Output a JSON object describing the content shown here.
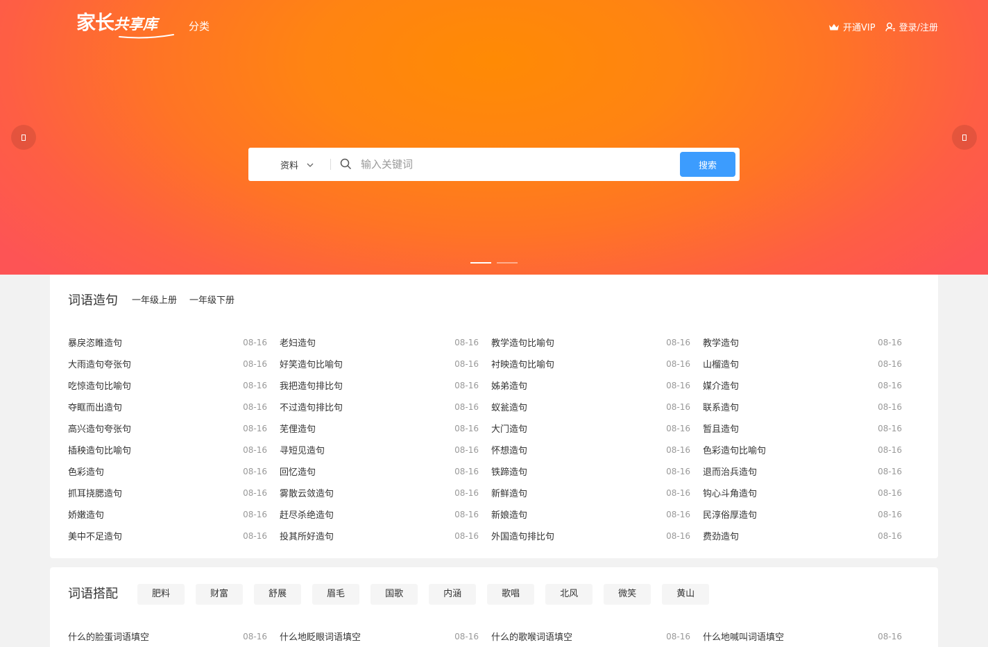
{
  "header": {
    "logo_main": "家长",
    "logo_sub": "共享库",
    "nav_category": "分类",
    "vip_label": "开通VIP",
    "login_label": "登录/注册"
  },
  "search": {
    "type_label": "资料",
    "placeholder": "输入关键词",
    "button_label": "搜索"
  },
  "icons": {
    "prev": "chevron-left-icon",
    "next": "chevron-right-icon",
    "vip": "crown-icon",
    "login": "user-icon",
    "search": "search-icon",
    "dropdown": "chevron-down-icon"
  },
  "colors": {
    "hero_center": "#ff8a04",
    "hero_edge": "#fd5455",
    "search_button": "#3c9cfe"
  },
  "carousel": {
    "slide_count": 2,
    "active_index": 0
  },
  "sections": [
    {
      "title": "词语造句",
      "tabs": [
        "一年级上册",
        "一年级下册"
      ],
      "items": [
        {
          "title": "暴戾恣睢造句",
          "date": "08-16"
        },
        {
          "title": "老妇造句",
          "date": "08-16"
        },
        {
          "title": "教学造句比喻句",
          "date": "08-16"
        },
        {
          "title": "教学造句",
          "date": "08-16"
        },
        {
          "title": "大雨造句夸张句",
          "date": "08-16"
        },
        {
          "title": "好笑造句比喻句",
          "date": "08-16"
        },
        {
          "title": "衬映造句比喻句",
          "date": "08-16"
        },
        {
          "title": "山榴造句",
          "date": "08-16"
        },
        {
          "title": "吃惊造句比喻句",
          "date": "08-16"
        },
        {
          "title": "我把造句排比句",
          "date": "08-16"
        },
        {
          "title": "姊弟造句",
          "date": "08-16"
        },
        {
          "title": "媒介造句",
          "date": "08-16"
        },
        {
          "title": "夺眶而出造句",
          "date": "08-16"
        },
        {
          "title": "不过造句排比句",
          "date": "08-16"
        },
        {
          "title": "蚁瓮造句",
          "date": "08-16"
        },
        {
          "title": "联系造句",
          "date": "08-16"
        },
        {
          "title": "高兴造句夸张句",
          "date": "08-16"
        },
        {
          "title": "芜俚造句",
          "date": "08-16"
        },
        {
          "title": "大门造句",
          "date": "08-16"
        },
        {
          "title": "暂且造句",
          "date": "08-16"
        },
        {
          "title": "插秧造句比喻句",
          "date": "08-16"
        },
        {
          "title": "寻短见造句",
          "date": "08-16"
        },
        {
          "title": "怀想造句",
          "date": "08-16"
        },
        {
          "title": "色彩造句比喻句",
          "date": "08-16"
        },
        {
          "title": "色彩造句",
          "date": "08-16"
        },
        {
          "title": "回忆造句",
          "date": "08-16"
        },
        {
          "title": "铁蹄造句",
          "date": "08-16"
        },
        {
          "title": "退而治兵造句",
          "date": "08-16"
        },
        {
          "title": "抓耳挠腮造句",
          "date": "08-16"
        },
        {
          "title": "雾散云敛造句",
          "date": "08-16"
        },
        {
          "title": "新鲜造句",
          "date": "08-16"
        },
        {
          "title": "钩心斗角造句",
          "date": "08-16"
        },
        {
          "title": "娇嫩造句",
          "date": "08-16"
        },
        {
          "title": "赶尽杀绝造句",
          "date": "08-16"
        },
        {
          "title": "新娘造句",
          "date": "08-16"
        },
        {
          "title": "民淳俗厚造句",
          "date": "08-16"
        },
        {
          "title": "美中不足造句",
          "date": "08-16"
        },
        {
          "title": "投其所好造句",
          "date": "08-16"
        },
        {
          "title": "外国造句排比句",
          "date": "08-16"
        },
        {
          "title": "费劲造句",
          "date": "08-16"
        }
      ]
    },
    {
      "title": "词语搭配",
      "tags": [
        "肥料",
        "财富",
        "舒展",
        "眉毛",
        "国歌",
        "内涵",
        "歌唱",
        "北风",
        "微笑",
        "黄山"
      ],
      "items": [
        {
          "title": "什么的脸蛋词语填空",
          "date": "08-16"
        },
        {
          "title": "什么地眨眼词语填空",
          "date": "08-16"
        },
        {
          "title": "什么的歌喉词语填空",
          "date": "08-16"
        },
        {
          "title": "什么地喊叫词语填空",
          "date": "08-16"
        }
      ]
    }
  ]
}
